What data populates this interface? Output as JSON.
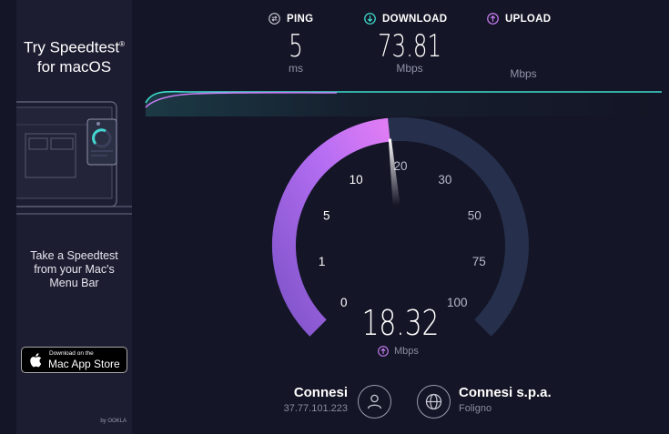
{
  "ad": {
    "title_line1": "Try Speedtest",
    "title_reg": "®",
    "title_line2": "for macOS",
    "sub_line1": "Take a Speedtest",
    "sub_line2": "from your Mac's",
    "sub_line3": "Menu Bar",
    "appstore_small": "Download on the",
    "appstore_big": "Mac App Store",
    "ookla": "by OOKLA"
  },
  "metrics": {
    "ping": {
      "label": "PING",
      "value": "5",
      "unit": "ms",
      "icon": "ping-icon"
    },
    "download": {
      "label": "DOWNLOAD",
      "value": "73.81",
      "unit": "Mbps",
      "icon": "download-arrow-icon"
    },
    "upload": {
      "label": "UPLOAD",
      "value": "",
      "unit": "Mbps",
      "icon": "upload-arrow-icon"
    }
  },
  "gauge": {
    "ticks": [
      "0",
      "1",
      "5",
      "10",
      "20",
      "30",
      "50",
      "75",
      "100"
    ],
    "current_value": 18.32,
    "speed": "18.32",
    "speed_unit": "Mbps"
  },
  "isp": {
    "name": "Connesi",
    "ip": "37.77.101.223",
    "server_name": "Connesi s.p.a.",
    "server_location": "Foligno"
  },
  "colors": {
    "background": "#141526",
    "ad_background": "#1d1d32",
    "gauge_track": "#26304c",
    "gauge_fill": "#b46df2",
    "download_accent": "#3ee0d0",
    "upload_accent": "#c87ef5"
  }
}
